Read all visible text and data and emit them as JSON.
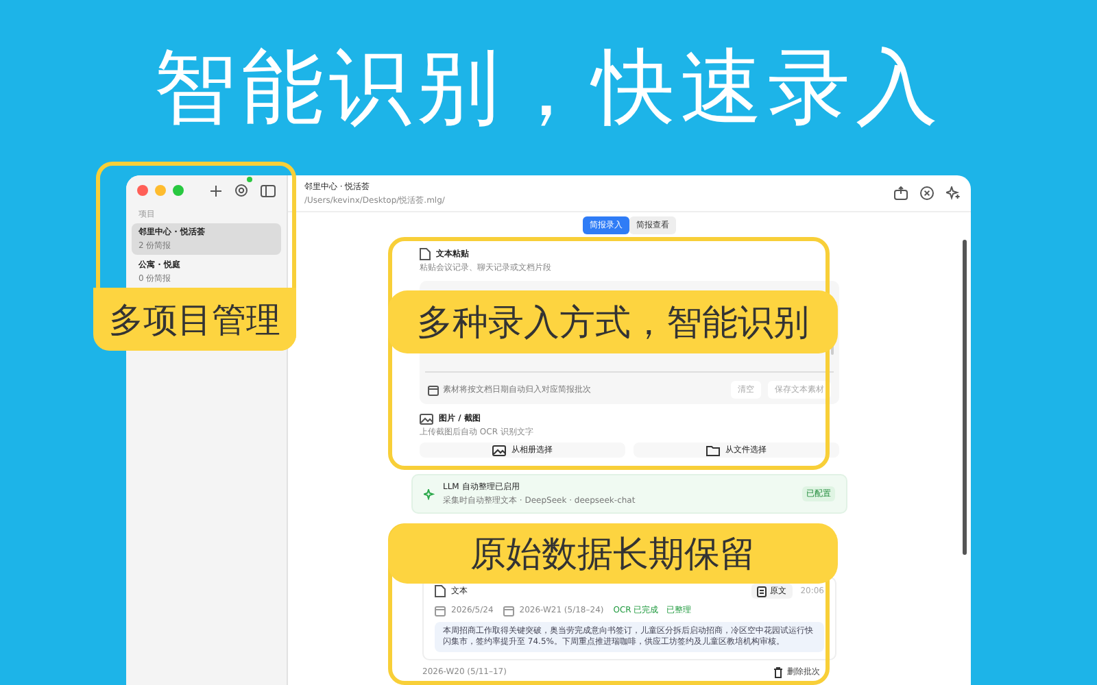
{
  "headline": "智能识别，快速录入",
  "callouts": [
    {
      "label": "多项目管理",
      "kind": "sidebar"
    },
    {
      "label": "多种录入方式，智能识别",
      "kind": "input"
    },
    {
      "label": "原始数据长期保留",
      "kind": "storage"
    }
  ],
  "sidebar": {
    "section": "项目",
    "items": [
      {
        "name": "邻里中心 · 悦活荟",
        "count": "2 份简报",
        "selected": true
      },
      {
        "name": "公寓 · 悦庭",
        "count": "0 份简报",
        "selected": false
      }
    ]
  },
  "header": {
    "title": "邻里中心 · 悦活荟",
    "path": "/Users/kevinx/Desktop/悦活荟.mlg/"
  },
  "tabs": [
    {
      "label": "简报录入",
      "selected": true
    },
    {
      "label": "简报查看",
      "selected": false
    }
  ],
  "text_paste": {
    "title": "文本粘贴",
    "subtitle": "粘贴会议记录、聊天记录或文档片段",
    "hint": "素材将按文档日期自动归入对应简报批次",
    "buttons": [
      "清空",
      "保存文本素材"
    ]
  },
  "image_input": {
    "title": "图片 / 截图",
    "subtitle": "上传截图后自动 OCR 识别文字",
    "buttons": [
      "从相册选择",
      "从文件选择"
    ]
  },
  "llm": {
    "title": "LLM 自动整理已启用",
    "subtitle": "采集时自动整理文本 · DeepSeek · deepseek-chat",
    "badge": "已配置"
  },
  "collected": {
    "items": [
      {
        "type": "文本",
        "source_button": "原文",
        "time": "20:06",
        "date": "2026/5/24",
        "batch": "2026-W21 (5/18–24)",
        "tags": [
          "OCR 已完成",
          "已整理"
        ],
        "summary": "本周招商工作取得关键突破，奥当劳完成意向书签订，儿童区分拆后启动招商，冷区空中花园试运行快闪集市，签约率提升至 74.5%。下周重点推进瑞咖啡，供应工坊签约及儿童区教培机构审核。"
      }
    ],
    "next_batch": {
      "week": "2026-W20 (5/11–17)",
      "delete": "删除批次"
    }
  }
}
